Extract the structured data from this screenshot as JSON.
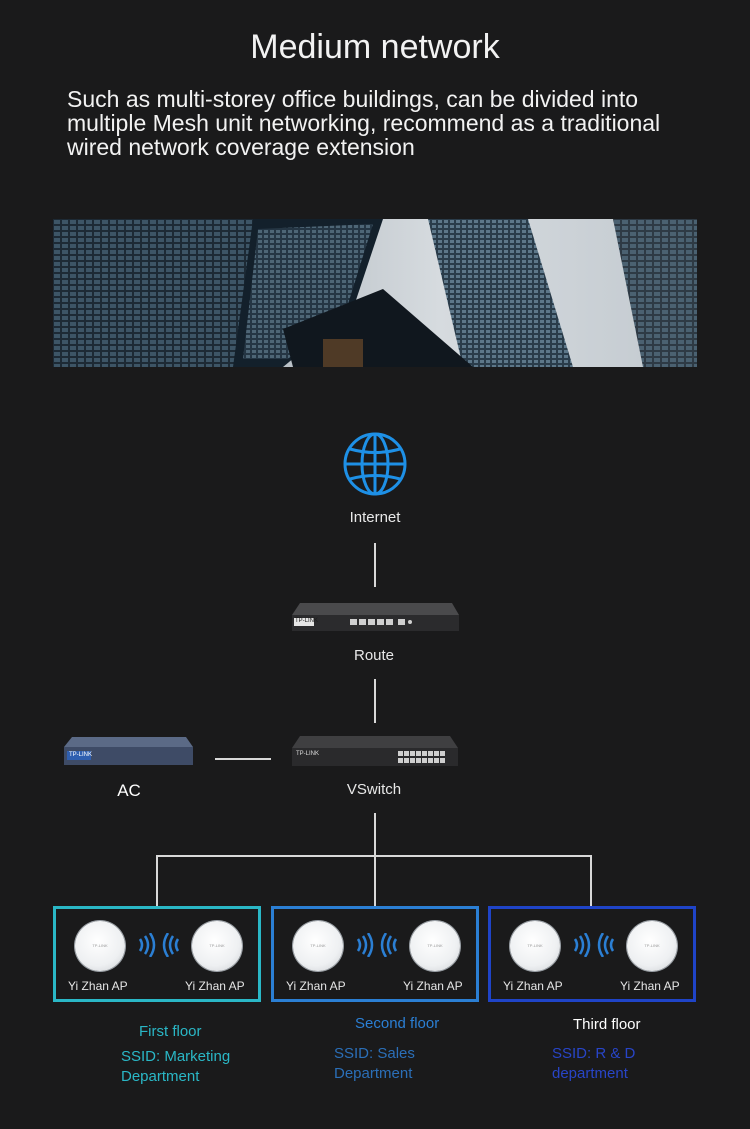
{
  "title": "Medium network",
  "subtitle": "Such as multi-storey office buildings, can be divided into multiple Mesh unit networking, recommend as a traditional wired network coverage extension",
  "nodes": {
    "internet": "Internet",
    "router": "Route",
    "ac": "AC",
    "switch": "VSwitch"
  },
  "brand_label": "TP-LINK",
  "floors": [
    {
      "name": "First floor",
      "ssid_line1": "SSID: Marketing",
      "ssid_line2": "Department",
      "ap_left": "Yi Zhan AP",
      "ap_right": "Yi Zhan AP",
      "color": "#2ab7c6"
    },
    {
      "name": "Second floor",
      "ssid_line1": "SSID: Sales",
      "ssid_line2": "Department",
      "ap_left": "Yi Zhan AP",
      "ap_right": "Yi Zhan AP",
      "color": "#2b7fd4"
    },
    {
      "name": "Third floor",
      "ssid_line1": "SSID: R & D",
      "ssid_line2": "department",
      "ap_left": "Yi Zhan AP",
      "ap_right": "Yi Zhan AP",
      "color": "#1f44c8"
    }
  ],
  "colors": {
    "background": "#1a1a1b",
    "globe": "#1e90e6",
    "floor1_text": "#2ab7c6",
    "floor2_text": "#2b7fd4",
    "floor3_text": "#ffffff",
    "ssid1_text": "#2ab7c6",
    "ssid2_text": "#2b6fb8",
    "ssid3_text": "#2845c8"
  }
}
